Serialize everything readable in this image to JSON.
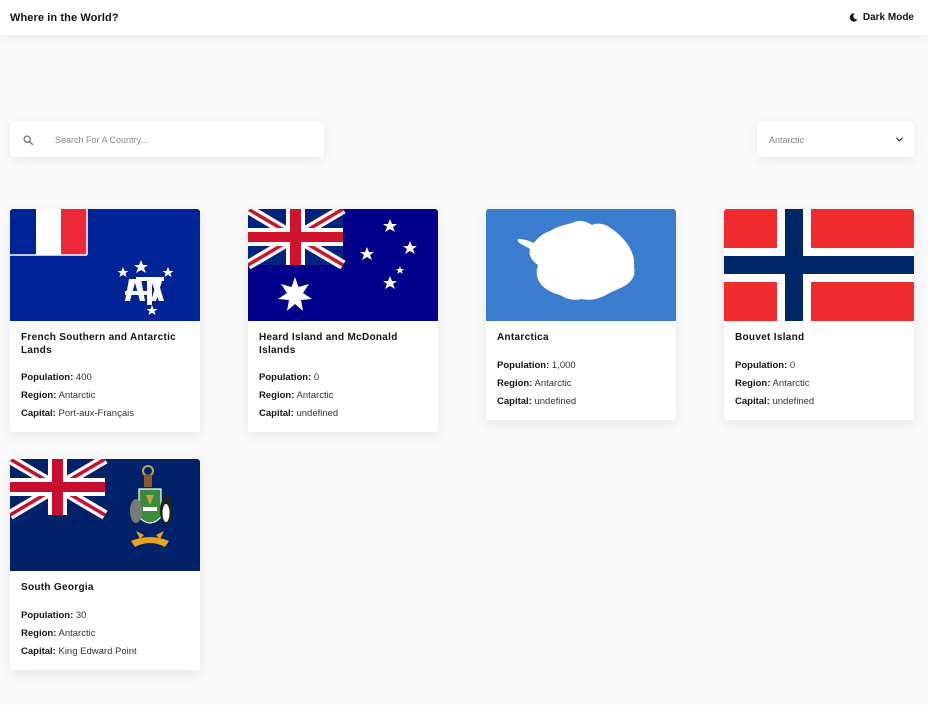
{
  "header": {
    "title": "Where in the World?",
    "theme_toggle_label": "Dark Mode",
    "theme_toggle_icon": "moon-icon"
  },
  "search": {
    "icon": "search-icon",
    "placeholder": "Search For A Country...",
    "value": ""
  },
  "filter": {
    "selected": "Antarctic",
    "icon": "chevron-down-icon"
  },
  "labels": {
    "population": "Population:",
    "region": "Region:",
    "capital": "Capital:"
  },
  "colors": {
    "background": "#fafafa",
    "card": "#ffffff",
    "text": "#111517"
  },
  "countries": [
    {
      "name": "French Southern and Antarctic Lands",
      "population": "400",
      "region": "Antarctic",
      "capital": "Port-aux-Français",
      "flag": "french-southern-lands-flag"
    },
    {
      "name": "Heard Island and McDonald Islands",
      "population": "0",
      "region": "Antarctic",
      "capital": "undefined",
      "flag": "heard-island-flag"
    },
    {
      "name": "Antarctica",
      "population": "1,000",
      "region": "Antarctic",
      "capital": "undefined",
      "flag": "antarctica-flag"
    },
    {
      "name": "Bouvet Island",
      "population": "0",
      "region": "Antarctic",
      "capital": "undefined",
      "flag": "bouvet-island-flag"
    },
    {
      "name": "South Georgia",
      "population": "30",
      "region": "Antarctic",
      "capital": "King Edward Point",
      "flag": "south-georgia-flag"
    }
  ]
}
